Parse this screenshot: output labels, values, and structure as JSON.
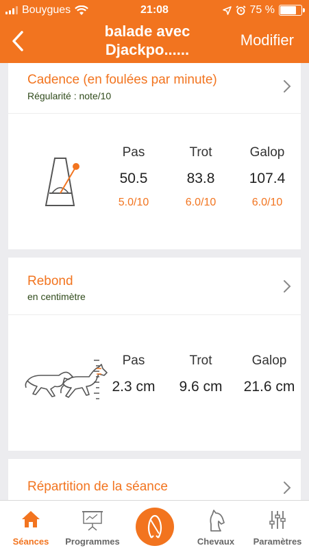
{
  "status_bar": {
    "carrier": "Bouygues",
    "time": "21:08",
    "battery": "75 %",
    "battery_level": 0.75
  },
  "header": {
    "title_line1": "balade avec",
    "title_line2": "Djackpo......",
    "action": "Modifier",
    "color": "#f2741f"
  },
  "cadence": {
    "title": "Cadence (en foulées par minute)",
    "subtitle": "Régularité : note/10",
    "columns": [
      {
        "label": "Pas",
        "value": "50.5",
        "score": "5.0/10"
      },
      {
        "label": "Trot",
        "value": "83.8",
        "score": "6.0/10"
      },
      {
        "label": "Galop",
        "value": "107.4",
        "score": "6.0/10"
      }
    ]
  },
  "rebond": {
    "title": "Rebond",
    "subtitle": "en centimètre",
    "columns": [
      {
        "label": "Pas",
        "value": "2.3 cm"
      },
      {
        "label": "Trot",
        "value": "9.6 cm"
      },
      {
        "label": "Galop",
        "value": "21.6 cm"
      }
    ]
  },
  "repartition": {
    "title": "Répartition de la séance"
  },
  "tabbar": {
    "items": [
      {
        "label": "Séances",
        "icon": "home-icon",
        "active": true
      },
      {
        "label": "Programmes",
        "icon": "presentation-board-icon"
      },
      {
        "label": "",
        "icon": "horseshoe-icon"
      },
      {
        "label": "Chevaux",
        "icon": "horse-head-icon"
      },
      {
        "label": "Paramètres",
        "icon": "sliders-icon"
      }
    ]
  }
}
